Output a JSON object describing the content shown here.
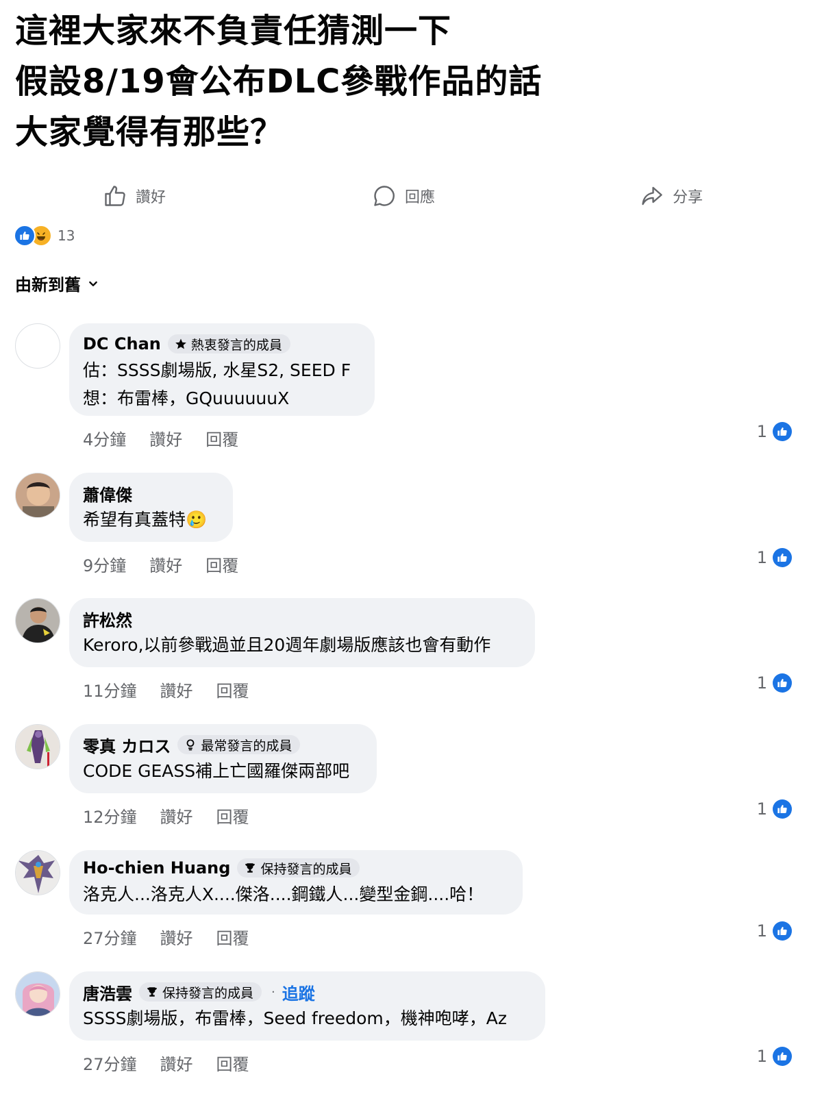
{
  "post": {
    "text": "這裡大家來不負責任猜測一下\n假設8/19會公布DLC參戰作品的話\n大家覺得有那些？"
  },
  "actions": {
    "like": "讚好",
    "comment": "回應",
    "share": "分享"
  },
  "reactions": {
    "count": "13"
  },
  "sort": {
    "label": "由新到舊"
  },
  "colors": {
    "accent": "#1b74e4",
    "bubble": "#f0f2f5",
    "secondary_text": "#65676b"
  },
  "comments": [
    {
      "author": "DC  Chan",
      "badge": "熱衷發言的成員",
      "badge_icon": "star-icon",
      "text": "估：SSSS劇場版, 水星S2, SEED F\n想：布雷棒，GQuuuuuuX",
      "time": "4分鐘",
      "like": "讚好",
      "reply": "回覆",
      "likes": "1"
    },
    {
      "author": "蕭偉傑",
      "text": "希望有真蓋特🥲",
      "time": "9分鐘",
      "like": "讚好",
      "reply": "回覆",
      "likes": "1"
    },
    {
      "author": "許松然",
      "text": "Keroro,以前參戰過並且20週年劇場版應該也會有動作",
      "time": "11分鐘",
      "like": "讚好",
      "reply": "回覆",
      "likes": "1"
    },
    {
      "author": "零真 カロス",
      "badge": "最常發言的成員",
      "badge_icon": "bulb-icon",
      "text": "CODE GEASS補上亡國羅傑兩部吧",
      "time": "12分鐘",
      "like": "讚好",
      "reply": "回覆",
      "likes": "1"
    },
    {
      "author": "Ho-chien Huang",
      "badge": "保持發言的成員",
      "badge_icon": "trophy-icon",
      "text": "洛克人...洛克人X....傑洛....鋼鐵人...變型金鋼....哈！",
      "time": "27分鐘",
      "like": "讚好",
      "reply": "回覆",
      "likes": "1"
    },
    {
      "author": "唐浩雲",
      "badge": "保持發言的成員",
      "badge_icon": "trophy-icon",
      "follow": "追蹤",
      "text": "SSSS劇場版，布雷棒，Seed freedom，機神咆哮，Az",
      "time": "27分鐘",
      "like": "讚好",
      "reply": "回覆",
      "likes": "1"
    }
  ]
}
